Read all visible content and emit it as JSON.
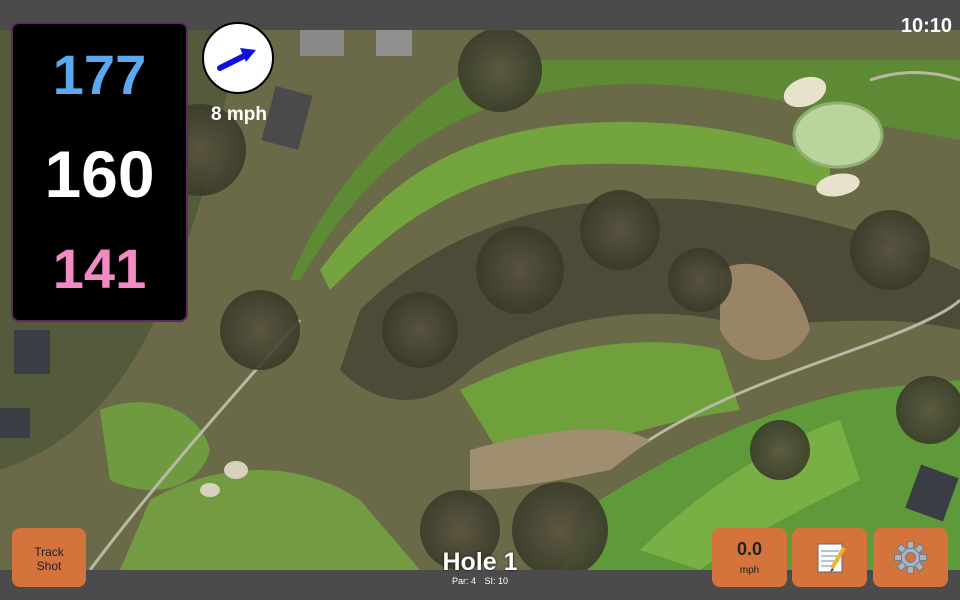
{
  "status": {
    "time": "10:10"
  },
  "distances": {
    "back": "177",
    "center": "160",
    "front": "141"
  },
  "wind": {
    "speed_label": "8 mph"
  },
  "hole": {
    "title": "Hole 1",
    "par": "Par: 4",
    "si": "SI: 10"
  },
  "buttons": {
    "track_shot": "Track\nShot",
    "wind_value": "0.0",
    "wind_unit": "mph",
    "notes_icon": "notepad-icon",
    "settings_icon": "gear-icon"
  },
  "colors": {
    "back": "#5aaaf2",
    "center": "#ffffff",
    "front": "#f28ac4",
    "button": "#d4733c",
    "wind_arrow": "#1010e0"
  }
}
